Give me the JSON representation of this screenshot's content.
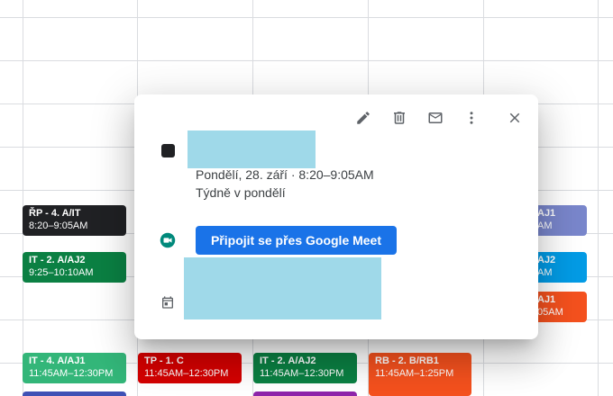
{
  "events": [
    {
      "title": "ŘP - 4. A/IT",
      "time": "8:20–9:05AM",
      "color": "#202124"
    },
    {
      "title": "IT - 2. A/AJ2",
      "time": "9:25–10:10AM",
      "color": "#0b8043"
    },
    {
      "title": "AJ1",
      "time": "AM",
      "color": "#7986cb"
    },
    {
      "title": "AJ2",
      "time": "AM",
      "color": "#039be5"
    },
    {
      "title": "AJ1",
      "time": "05AM",
      "color": "#f4511e"
    },
    {
      "title": "IT - 4. A/AJ1",
      "time": "11:45AM–12:30PM",
      "color": "#33b679"
    },
    {
      "title": "TP - 1. C",
      "time": "11:45AM–12:30PM",
      "color": "#d50000"
    },
    {
      "title": "IT - 2. A/AJ2",
      "time": "11:45AM–12:30PM",
      "color": "#0b8043"
    },
    {
      "title": "RB - 2. B/RB1",
      "time": "11:45AM–1:25PM",
      "color": "#f4511e"
    }
  ],
  "popup": {
    "date_line": "Pondělí, 28. září  ·  8:20–9:05AM",
    "recurrence": "Týdně v pondělí",
    "meet_button": "Připojit se přes Google Meet"
  }
}
